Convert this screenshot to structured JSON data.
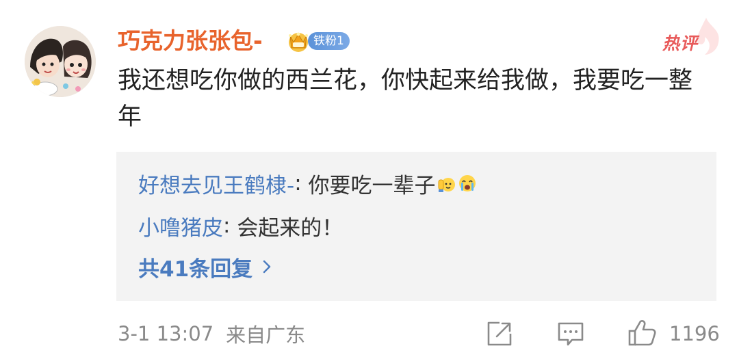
{
  "post": {
    "username": "巧克力张张包-",
    "fan_badge": "铁粉1",
    "hot_badge": "热评",
    "comment_text": "我还想吃你做的西兰花，你快起来给我做，我要吃一整年"
  },
  "replies": [
    {
      "author": "好想去见王鹤棣-",
      "separator": ": ",
      "text": "你要吃一辈子"
    },
    {
      "author": "小噜猪皮",
      "separator": ": ",
      "text": "会起来的！"
    }
  ],
  "more_replies_label": "共41条回复",
  "footer": {
    "timestamp": "3-1 13:07",
    "location": "来自广东",
    "like_count": "1196"
  },
  "colors": {
    "username": "#e8632c",
    "reply_author": "#4a7bbf",
    "fan_pill": "#5b92d8",
    "hot": "#e85a5a",
    "reply_bg": "#f3f3f3",
    "meta": "#8a8a8a"
  },
  "icons": [
    "avatar-image",
    "crown-icon",
    "share-icon",
    "comment-icon",
    "like-icon",
    "chevron-right-icon",
    "raised-hand-emoji",
    "crying-face-emoji"
  ]
}
